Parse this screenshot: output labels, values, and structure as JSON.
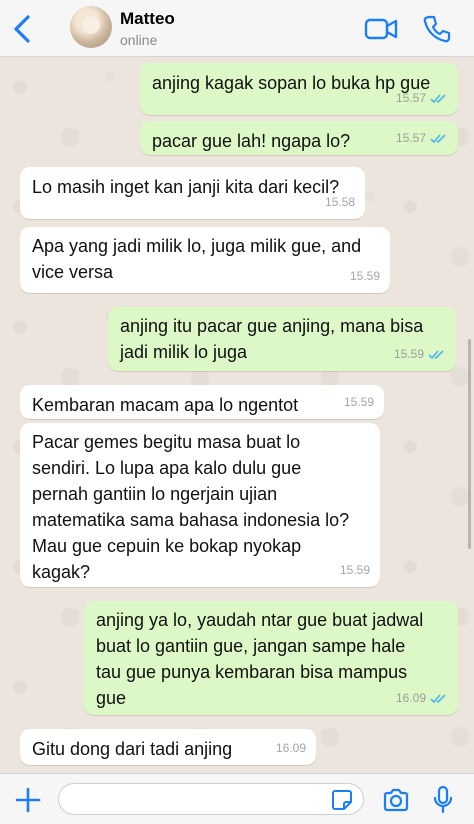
{
  "header": {
    "contact_name": "Matteo",
    "status": "online",
    "icons": [
      "chevron-left-icon",
      "video-call-icon",
      "phone-call-icon"
    ],
    "accent_color": "#1a7efb"
  },
  "messages": [
    {
      "direction": "outgoing",
      "lines": [
        "anjing kagak sopan lo buka hp gue"
      ],
      "time": "15.57",
      "read": true
    },
    {
      "direction": "outgoing",
      "lines": [
        "pacar gue lah! ngapa lo?"
      ],
      "time": "15.57",
      "read": true
    },
    {
      "direction": "incoming",
      "lines": [
        "Lo masih inget kan janji kita dari kecil?"
      ],
      "time": "15.58"
    },
    {
      "direction": "incoming",
      "lines": [
        "Apa yang jadi milik lo, juga milik gue, and",
        "vice versa"
      ],
      "time": "15.59"
    },
    {
      "direction": "outgoing",
      "lines": [
        "anjing itu pacar gue anjing, mana bisa",
        "jadi milik lo juga"
      ],
      "time": "15.59",
      "read": true
    },
    {
      "direction": "incoming",
      "lines": [
        "Kembaran macam apa lo ngentot"
      ],
      "time": "15.59"
    },
    {
      "direction": "incoming",
      "lines": [
        "Pacar gemes begitu masa buat lo",
        "sendiri. Lo lupa apa kalo dulu gue",
        "pernah gantiin lo ngerjain ujian",
        "matematika sama bahasa indonesia lo?",
        "Mau gue cepuin ke bokap nyokap",
        "kagak?"
      ],
      "time": "15.59"
    },
    {
      "direction": "outgoing",
      "lines": [
        "anjing ya lo, yaudah ntar gue buat jadwal",
        "buat lo gantiin gue, jangan sampe hale",
        "tau gue punya kembaran bisa mampus",
        "gue"
      ],
      "time": "16.09",
      "read": true
    },
    {
      "direction": "incoming",
      "lines": [
        "Gitu dong dari tadi anjing"
      ],
      "time": "16.09"
    }
  ],
  "composer": {
    "icons": [
      "plus-icon",
      "sticker-icon",
      "camera-icon",
      "microphone-icon"
    ]
  },
  "colors": {
    "outgoing_bubble": "#dcf8c6",
    "incoming_bubble": "#ffffff",
    "read_ticks": "#4fb6ec",
    "chat_background": "#ece5dd"
  }
}
